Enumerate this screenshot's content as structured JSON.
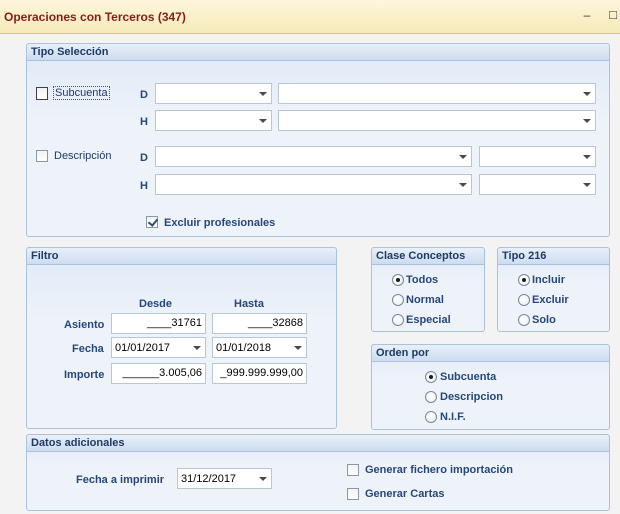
{
  "window": {
    "title": "Operaciones con Terceros (347)",
    "minimize_icon": "minimize-icon",
    "maximize_icon": "maximize-icon"
  },
  "tipo_seleccion": {
    "title": "Tipo Selección",
    "subcuenta_label": "Subcuenta",
    "descripcion_label": "Descripción",
    "d_label": "D",
    "h_label": "H",
    "excluir_label": "Excluir profesionales"
  },
  "filtro": {
    "title": "Filtro",
    "desde_header": "Desde",
    "hasta_header": "Hasta",
    "asiento_label": "Asiento",
    "asiento_desde": "____31761",
    "asiento_hasta": "____32868",
    "fecha_label": "Fecha",
    "fecha_desde": "01/01/2017",
    "fecha_hasta": "01/01/2018",
    "importe_label": "Importe",
    "importe_desde": "______3.005,06",
    "importe_hasta": "_999.999.999,00"
  },
  "clase_conceptos": {
    "title": "Clase Conceptos",
    "options": [
      "Todos",
      "Normal",
      "Especial"
    ],
    "selected": "Todos"
  },
  "tipo_216": {
    "title": "Tipo 216",
    "options": [
      "Incluir",
      "Excluir",
      "Solo"
    ],
    "selected": "Incluir"
  },
  "orden_por": {
    "title": "Orden por",
    "options": [
      "Subcuenta",
      "Descripcion",
      "N.I.F."
    ],
    "selected": "Subcuenta"
  },
  "datos_adicionales": {
    "title": "Datos adicionales",
    "fecha_imprimir_label": "Fecha a imprimir",
    "fecha_imprimir_value": "31/12/2017",
    "generar_fichero_label": "Generar fichero importación",
    "generar_cartas_label": "Generar Cartas"
  }
}
